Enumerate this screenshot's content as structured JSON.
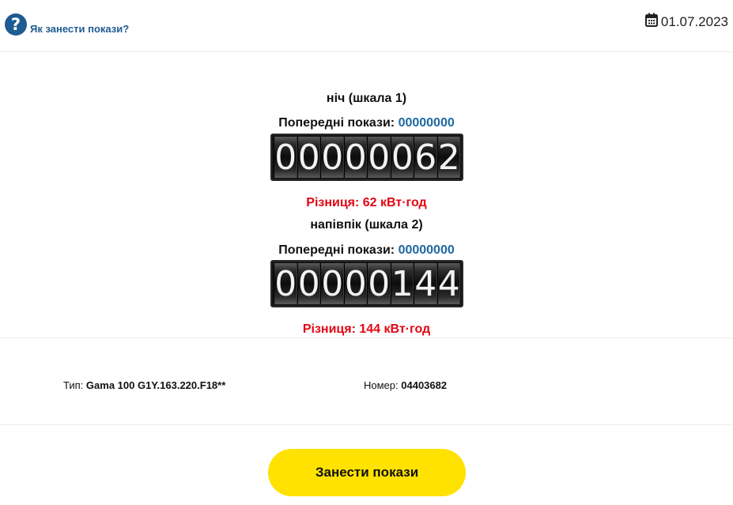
{
  "header": {
    "help_label": "Як занести покази?",
    "help_icon": "question-circle-icon",
    "date_icon": "calendar-icon",
    "date": "01.07.2023"
  },
  "scales": [
    {
      "title": "ніч (шкала 1)",
      "prev_label": "Попередні покази:",
      "prev_value": "00000000",
      "reading_digits": [
        "0",
        "0",
        "0",
        "0",
        "0",
        "0",
        "6",
        "2"
      ],
      "difference": "Різниця: 62 кВт·год"
    },
    {
      "title": "напівпік (шкала 2)",
      "prev_label": "Попередні покази:",
      "prev_value": "00000000",
      "reading_digits": [
        "0",
        "0",
        "0",
        "0",
        "0",
        "1",
        "4",
        "4"
      ],
      "difference": "Різниця: 144 кВт·год"
    }
  ],
  "meter": {
    "type_label": "Тип:",
    "type_value": "Gama 100 G1Y.163.220.F18**",
    "number_label": "Номер:",
    "number_value": "04403682"
  },
  "submit_label": "Занести покази",
  "colors": {
    "accent_blue": "#1e5b92",
    "value_blue": "#1e6aa3",
    "difference_red": "#e30613",
    "button_yellow": "#ffe200"
  }
}
